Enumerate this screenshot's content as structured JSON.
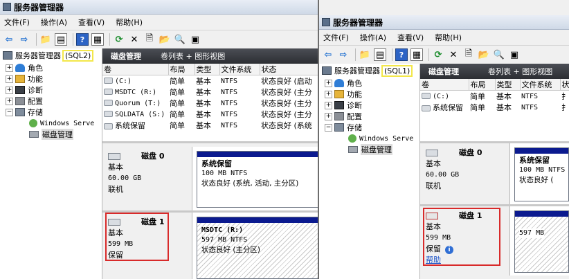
{
  "left_window": {
    "title": "服务器管理器",
    "menu": [
      "文件(F)",
      "操作(A)",
      "查看(V)",
      "帮助(H)"
    ],
    "tree": {
      "root": "服务器管理器",
      "server_tag": "(SQL2)",
      "items": [
        "角色",
        "功能",
        "诊断",
        "配置",
        "存储"
      ],
      "storage_children": [
        "Windows Serve",
        "磁盘管理"
      ]
    },
    "header": {
      "title": "磁盘管理",
      "view": "卷列表 + 图形视图"
    },
    "columns": [
      "卷",
      "布局",
      "类型",
      "文件系统",
      "状态"
    ],
    "volumes": [
      {
        "name": "(C:)",
        "layout": "简单",
        "type": "基本",
        "fs": "NTFS",
        "status": "状态良好 (启动"
      },
      {
        "name": "MSDTC (R:)",
        "layout": "简单",
        "type": "基本",
        "fs": "NTFS",
        "status": "状态良好 (主分"
      },
      {
        "name": "Quorum (T:)",
        "layout": "简单",
        "type": "基本",
        "fs": "NTFS",
        "status": "状态良好 (主分"
      },
      {
        "name": "SQLDATA (S:)",
        "layout": "简单",
        "type": "基本",
        "fs": "NTFS",
        "status": "状态良好 (主分"
      },
      {
        "name": "系统保留",
        "layout": "简单",
        "type": "基本",
        "fs": "NTFS",
        "status": "状态良好 (系统"
      }
    ],
    "disk0": {
      "name": "磁盘 0",
      "type": "基本",
      "size": "60.00 GB",
      "state": "联机",
      "partition": {
        "title": "系统保留",
        "size": "100 MB NTFS",
        "status": "状态良好 (系统, 活动, 主分区)"
      }
    },
    "disk1": {
      "name": "磁盘 1",
      "type": "基本",
      "size": "599 MB",
      "state": "保留",
      "partition": {
        "title": "MSDTC  (R:)",
        "size": "597 MB NTFS",
        "status": "状态良好 (主分区)"
      }
    }
  },
  "right_window": {
    "title": "服务器管理器",
    "menu": [
      "文件(F)",
      "操作(A)",
      "查看(V)",
      "帮助(H)"
    ],
    "tree": {
      "root": "服务器管理器",
      "server_tag": "(SQL1)",
      "items": [
        "角色",
        "功能",
        "诊断",
        "配置",
        "存储"
      ],
      "storage_children": [
        "Windows Serve",
        "磁盘管理"
      ]
    },
    "header": {
      "title": "磁盘管理",
      "view": "卷列表 + 图形视图"
    },
    "columns": [
      "卷",
      "布局",
      "类型",
      "文件系统",
      "状"
    ],
    "volumes": [
      {
        "name": "(C:)",
        "layout": "简单",
        "type": "基本",
        "fs": "NTFS",
        "status": "扌"
      },
      {
        "name": "系统保留",
        "layout": "简单",
        "type": "基本",
        "fs": "NTFS",
        "status": "扌"
      }
    ],
    "disk0": {
      "name": "磁盘 0",
      "type": "基本",
      "size": "60.00 GB",
      "state": "联机",
      "partition": {
        "title": "系统保留",
        "size": "100 MB NTFS",
        "status": "状态良好 ("
      }
    },
    "disk1": {
      "name": "磁盘 1",
      "type": "基本",
      "size": "599 MB",
      "state": "保留",
      "help": "帮助",
      "partition": {
        "size": "597 MB"
      }
    }
  }
}
